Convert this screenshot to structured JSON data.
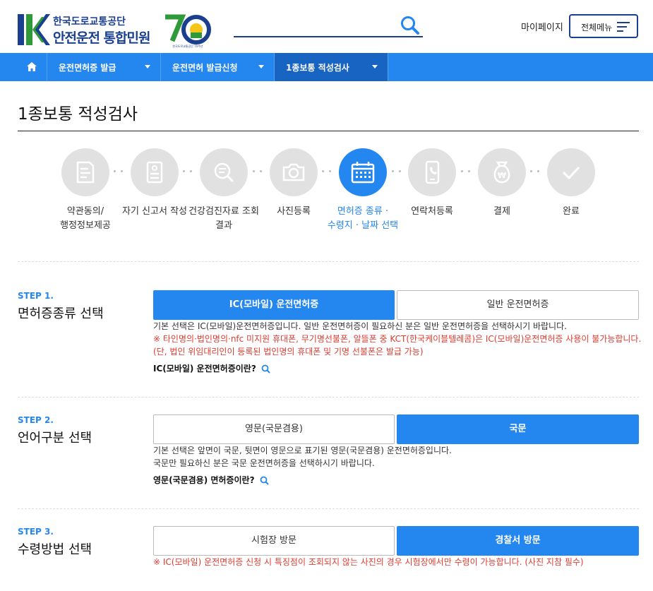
{
  "header": {
    "logo_line1": "한국도로교통공단",
    "logo_line2": "안전운전 통합민원",
    "logo_70_caption": "한국도로교통공단 70주년",
    "search_placeholder": "",
    "mypage_label": "마이페이지",
    "allmenu_label": "전체메뉴"
  },
  "nav": {
    "items": [
      {
        "label": "운전면허증 발급"
      },
      {
        "label": "운전면허 발급신청"
      },
      {
        "label": "1종보통 적성검사"
      }
    ]
  },
  "page_title": "1종보통 적성검사",
  "progress": {
    "current_index": 4,
    "steps": [
      {
        "label": "약관동의/\n행정정보제공",
        "icon": "document-icon"
      },
      {
        "label": "자기 신고서 작성",
        "icon": "form-icon"
      },
      {
        "label": "건강검진자료 조회\n결과",
        "icon": "search-doc-icon"
      },
      {
        "label": "사진등록",
        "icon": "camera-icon"
      },
      {
        "label": "면허증 종류 ·\n수령지 · 날짜 선택",
        "icon": "calendar-icon"
      },
      {
        "label": "연락처등록",
        "icon": "phone-icon"
      },
      {
        "label": "결제",
        "icon": "won-bag-icon"
      },
      {
        "label": "완료",
        "icon": "check-icon"
      }
    ]
  },
  "step1": {
    "tag": "STEP 1.",
    "title": "면허증종류 선택",
    "options": [
      "IC(모바일) 운전면허증",
      "일반 운전면허증"
    ],
    "selected": 0,
    "note": "기본 선택은 IC(모바일)운전면허증입니다. 일반 운전면허증이 필요하신 분은 일반 운전면허증을 선택하시기 바랍니다.",
    "warning1": "※ 타인명의·법인명의·nfc 미지원 휴대폰, 무기명선불폰, 알뜰폰 중 KCT(한국케이블텔레콤)은 IC(모바일)운전면허증 사용이 불가능합니다.",
    "warning2": "(단, 법인 위임대리인이 등록된 법인명의 휴대폰 및 기명 선불폰은 발급 가능)",
    "question": "IC(모바일) 운전면허증이란?"
  },
  "step2": {
    "tag": "STEP 2.",
    "title": "언어구분 선택",
    "options": [
      "영문(국문겸용)",
      "국문"
    ],
    "selected": 1,
    "note1": "기본 선택은 앞면이 국문, 뒷면이 영문으로 표기된 영문(국문겸용) 운전면허증입니다.",
    "note2": "국문만 필요하신 분은 국문 운전면허증을 선택하시기 바랍니다.",
    "question": "영문(국문겸용) 면허증이란?"
  },
  "step3": {
    "tag": "STEP 3.",
    "title": "수령방법 선택",
    "options": [
      "시험장 방문",
      "경찰서 방문"
    ],
    "selected": 1,
    "warning": "※ IC(모바일) 운전면허증 신청 시 특징점이 조회되지 않는 사진의 경우 시험장에서만 수령이 가능합니다. (사진 지참 필수)"
  },
  "colors": {
    "primary": "#2486ef",
    "nav_active": "#1764c2",
    "brand_navy": "#1a3f8f",
    "brand_green": "#2f9a3a",
    "warning": "#e03a2f",
    "inactive_circle": "#e1e1e1"
  }
}
